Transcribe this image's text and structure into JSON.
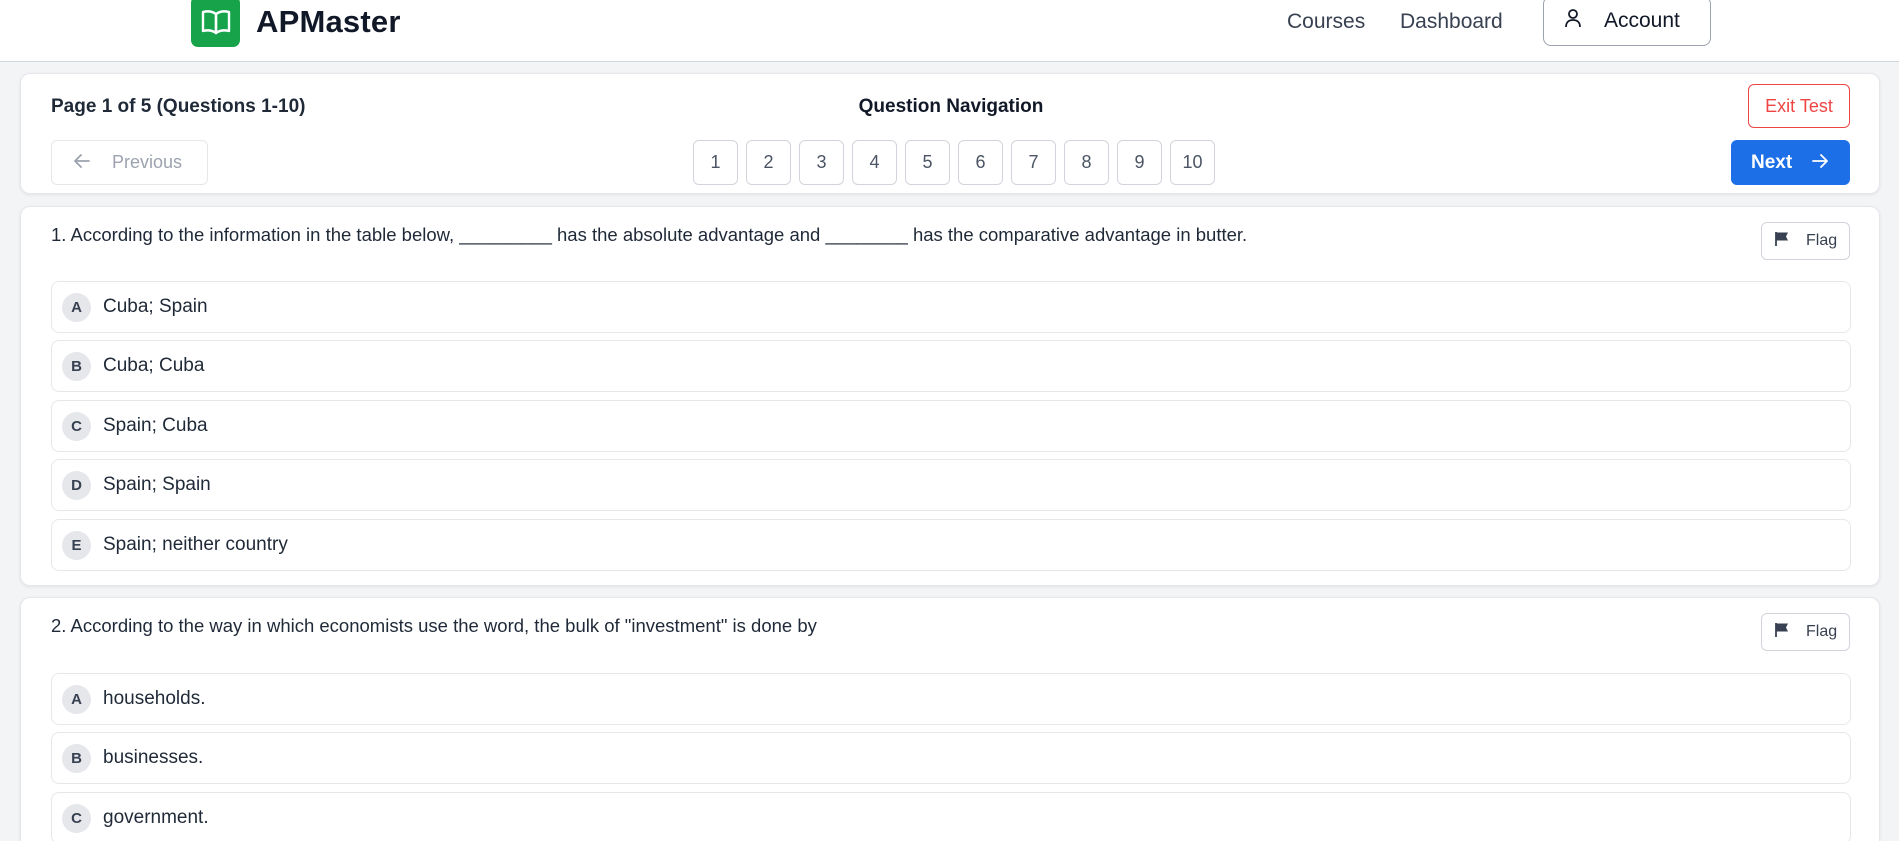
{
  "header": {
    "brand": "APMaster",
    "nav": {
      "courses": "Courses",
      "dashboard": "Dashboard",
      "account": "Account"
    },
    "accent": "#16a34a"
  },
  "navigation": {
    "page_info": "Page 1 of 5 (Questions 1-10)",
    "title": "Question Navigation",
    "exit_label": "Exit Test",
    "previous_label": "Previous",
    "next_label": "Next",
    "pages": [
      "1",
      "2",
      "3",
      "4",
      "5",
      "6",
      "7",
      "8",
      "9",
      "10"
    ],
    "next_color": "#1d6fe8",
    "exit_color": "#ef4444"
  },
  "questions": [
    {
      "text": "1. According to the information in the table below, _________ has the absolute advantage and ________ has the comparative advantage in butter.",
      "flag_label": "Flag",
      "options": [
        {
          "letter": "A",
          "text": "Cuba; Spain"
        },
        {
          "letter": "B",
          "text": "Cuba; Cuba"
        },
        {
          "letter": "C",
          "text": "Spain; Cuba"
        },
        {
          "letter": "D",
          "text": "Spain; Spain"
        },
        {
          "letter": "E",
          "text": "Spain; neither country"
        }
      ]
    },
    {
      "text": "2. According to the way in which economists use the word, the bulk of \"investment\" is done by",
      "flag_label": "Flag",
      "options": [
        {
          "letter": "A",
          "text": "households."
        },
        {
          "letter": "B",
          "text": "businesses."
        },
        {
          "letter": "C",
          "text": "government."
        }
      ]
    }
  ]
}
